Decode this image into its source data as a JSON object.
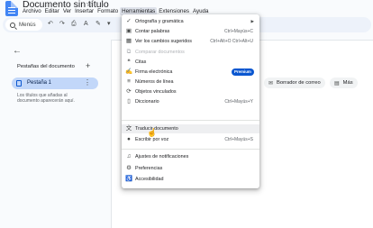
{
  "document": {
    "title": "Documento sin título"
  },
  "menubar": [
    "Archivo",
    "Editar",
    "Ver",
    "Insertar",
    "Formato",
    "Herramientas",
    "Extensiones",
    "Ayuda"
  ],
  "toolbar": {
    "search_label": "Menús"
  },
  "left_panel": {
    "heading": "Pestañas del documento",
    "tab_label": "Pestaña 1",
    "hint": "Los títulos que añadas al documento aparecerán aquí."
  },
  "chips": {
    "email_draft": "Borrador de correo",
    "more": "Más"
  },
  "tools_menu": {
    "items": [
      {
        "label": "Ortografía y gramática",
        "icon": "spellcheck-icon",
        "shortcut": "",
        "submenu": true
      },
      {
        "label": "Contar palabras",
        "icon": "word-count-icon",
        "shortcut": "Ctrl+Mayús+C"
      },
      {
        "label": "Ver los cambios sugeridos",
        "icon": "suggested-edits-icon",
        "shortcut": "Ctrl+Alt+O Ctrl+Alt+U"
      },
      {
        "label": "Comparar documentos",
        "icon": "compare-icon",
        "shortcut": "",
        "disabled": true
      },
      {
        "label": "Citas",
        "icon": "quote-icon",
        "shortcut": ""
      },
      {
        "label": "Firma electrónica",
        "icon": "signature-icon",
        "shortcut": "",
        "badge": "Premium"
      },
      {
        "label": "Números de línea",
        "icon": "line-numbers-icon",
        "shortcut": ""
      },
      {
        "label": "Objetos vinculados",
        "icon": "linked-objects-icon",
        "shortcut": ""
      },
      {
        "label": "Diccionario",
        "icon": "dictionary-icon",
        "shortcut": "Ctrl+Mayús+Y"
      },
      {
        "label": "Traducir documento",
        "icon": "translate-icon",
        "shortcut": ""
      },
      {
        "label": "Escribir por voz",
        "icon": "microphone-icon",
        "shortcut": "Ctrl+Mayús+S"
      },
      {
        "label": "Ajustes de notificaciones",
        "icon": "bell-icon",
        "shortcut": ""
      },
      {
        "label": "Preferencias",
        "icon": "preferences-icon",
        "shortcut": ""
      },
      {
        "label": "Accesibilidad",
        "icon": "accessibility-icon",
        "shortcut": ""
      }
    ]
  }
}
